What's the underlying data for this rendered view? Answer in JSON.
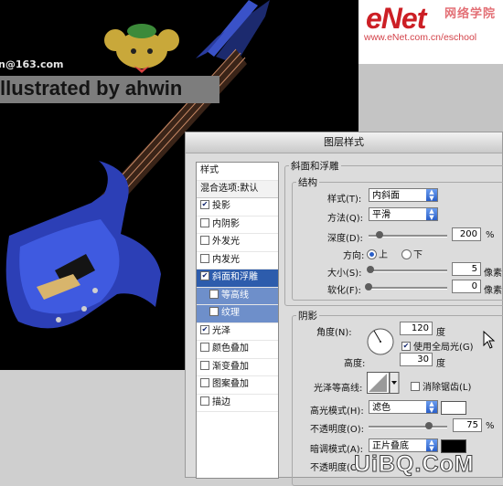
{
  "canvas": {
    "email": "n@163.com",
    "banner": "llustrated by ahwin"
  },
  "logo": {
    "brand": "eNet",
    "brand_cn": "网络学院",
    "url": "www.eNet.com.cn/eschool"
  },
  "dialog": {
    "title": "图层样式",
    "styles_list": {
      "header": "样式",
      "blend_options": "混合选项:默认",
      "items": [
        {
          "label": "投影",
          "checked": true
        },
        {
          "label": "内阴影",
          "checked": false
        },
        {
          "label": "外发光",
          "checked": false
        },
        {
          "label": "内发光",
          "checked": false
        },
        {
          "label": "斜面和浮雕",
          "checked": true,
          "selected": true
        },
        {
          "label": "等高线",
          "checked": false,
          "sub": true
        },
        {
          "label": "纹理",
          "checked": false,
          "sub": true
        },
        {
          "label": "光泽",
          "checked": true
        },
        {
          "label": "颜色叠加",
          "checked": false
        },
        {
          "label": "渐变叠加",
          "checked": false
        },
        {
          "label": "图案叠加",
          "checked": false
        },
        {
          "label": "描边",
          "checked": false
        }
      ]
    },
    "bevel": {
      "title": "斜面和浮雕",
      "structure": "结构",
      "style_label": "样式(T):",
      "style_value": "内斜面",
      "technique_label": "方法(Q):",
      "technique_value": "平滑",
      "depth_label": "深度(D):",
      "depth_value": "200",
      "depth_unit": "%",
      "direction_label": "方向:",
      "direction_up": "上",
      "direction_down": "下",
      "size_label": "大小(S):",
      "size_value": "5",
      "size_unit": "像素",
      "soften_label": "软化(F):",
      "soften_value": "0",
      "soften_unit": "像素"
    },
    "shading": {
      "title": "阴影",
      "angle_label": "角度(N):",
      "angle_value": "120",
      "angle_unit": "度",
      "global_light_label": "使用全局光(G)",
      "altitude_label": "高度:",
      "altitude_value": "30",
      "altitude_unit": "度",
      "gloss_label": "光泽等高线:",
      "antialias_label": "消除锯齿(L)",
      "highlight_mode_label": "高光模式(H):",
      "highlight_mode_value": "滤色",
      "highlight_color": "#ffffff",
      "highlight_opacity_label": "不透明度(O):",
      "highlight_opacity_value": "75",
      "highlight_opacity_unit": "%",
      "shadow_mode_label": "暗调模式(A):",
      "shadow_mode_value": "正片叠底",
      "shadow_color": "#000000",
      "shadow_opacity_label": "不透明度(C)"
    }
  },
  "watermark": "UiBQ.CoM"
}
